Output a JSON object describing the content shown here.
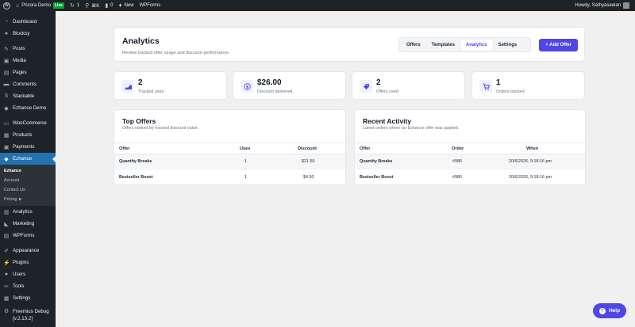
{
  "adminbar": {
    "site_name": "Pricora Demo",
    "live_badge": "Live",
    "updates_count": "1",
    "search_k": "⌘K",
    "comments_count": "0",
    "new_label": "New",
    "wpforms_label": "WPForms",
    "howdy": "Howdy, Sathyaseelan"
  },
  "sidebar": {
    "items": [
      {
        "label": "Dashboard",
        "icon": "dashboard-icon"
      },
      {
        "label": "Blocksy",
        "icon": "blocksy-icon"
      },
      {
        "label": "Posts",
        "icon": "pin-icon"
      },
      {
        "label": "Media",
        "icon": "media-icon"
      },
      {
        "label": "Pages",
        "icon": "pages-icon"
      },
      {
        "label": "Comments",
        "icon": "comment-icon"
      },
      {
        "label": "Stackable",
        "icon": "stackable-icon"
      },
      {
        "label": "Ezhance Demo",
        "icon": "ezhance-icon"
      },
      {
        "label": "WooCommerce",
        "icon": "woo-icon"
      },
      {
        "label": "Products",
        "icon": "products-icon"
      },
      {
        "label": "Payments",
        "icon": "payments-icon"
      },
      {
        "label": "Ezhance",
        "icon": "ezhance-icon"
      },
      {
        "label": "Analytics",
        "icon": "analytics-icon"
      },
      {
        "label": "Marketing",
        "icon": "megaphone-icon"
      },
      {
        "label": "WPForms",
        "icon": "forms-icon"
      },
      {
        "label": "Appearance",
        "icon": "brush-icon"
      },
      {
        "label": "Plugins",
        "icon": "plugin-icon"
      },
      {
        "label": "Users",
        "icon": "user-icon"
      },
      {
        "label": "Tools",
        "icon": "wrench-icon"
      },
      {
        "label": "Settings",
        "icon": "settings-icon"
      },
      {
        "label": "Freemius Debug",
        "icon": "gear-icon"
      },
      {
        "label": "[v.2.13.2]",
        "icon": ""
      }
    ],
    "submenu": [
      "Ezhance",
      "Account",
      "Contact Us",
      "Pricing ►"
    ]
  },
  "header": {
    "title": "Analytics",
    "subtitle": "Review tracked offer usage and discount performance.",
    "tabs": [
      "Offers",
      "Templates",
      "Analytics",
      "Settings"
    ],
    "add_button": "+ Add Offer"
  },
  "stats": [
    {
      "value": "2",
      "label": "Tracked uses",
      "icon": "chart-icon"
    },
    {
      "value": "$26.00",
      "label": "Discount delivered",
      "icon": "dollar-icon"
    },
    {
      "value": "2",
      "label": "Offers used",
      "icon": "tag-icon"
    },
    {
      "value": "1",
      "label": "Orders tracked",
      "icon": "cart-icon"
    }
  ],
  "top_offers": {
    "title": "Top Offers",
    "subtitle": "Offers ranked by tracked discount value.",
    "columns": [
      "Offer",
      "Uses",
      "Discount"
    ],
    "rows": [
      [
        "Quantity Breaks",
        "1",
        "$21.50"
      ],
      [
        "Bestseller Boost",
        "1",
        "$4.50"
      ]
    ]
  },
  "recent_activity": {
    "title": "Recent Activity",
    "subtitle": "Latest orders where an Ezhance offer was applied.",
    "columns": [
      "Offer",
      "Order",
      "When"
    ],
    "rows": [
      [
        "Quantity Breaks",
        "#986",
        "20/6/2026, 9:18:16 pm"
      ],
      [
        "Bestseller Boost",
        "#986",
        "20/6/2026, 9:18:16 pm"
      ]
    ]
  },
  "help": {
    "label": "Help"
  },
  "colors": {
    "accent": "#4f46e5",
    "admin_dark": "#1d2327",
    "wp_blue": "#2271b1"
  }
}
